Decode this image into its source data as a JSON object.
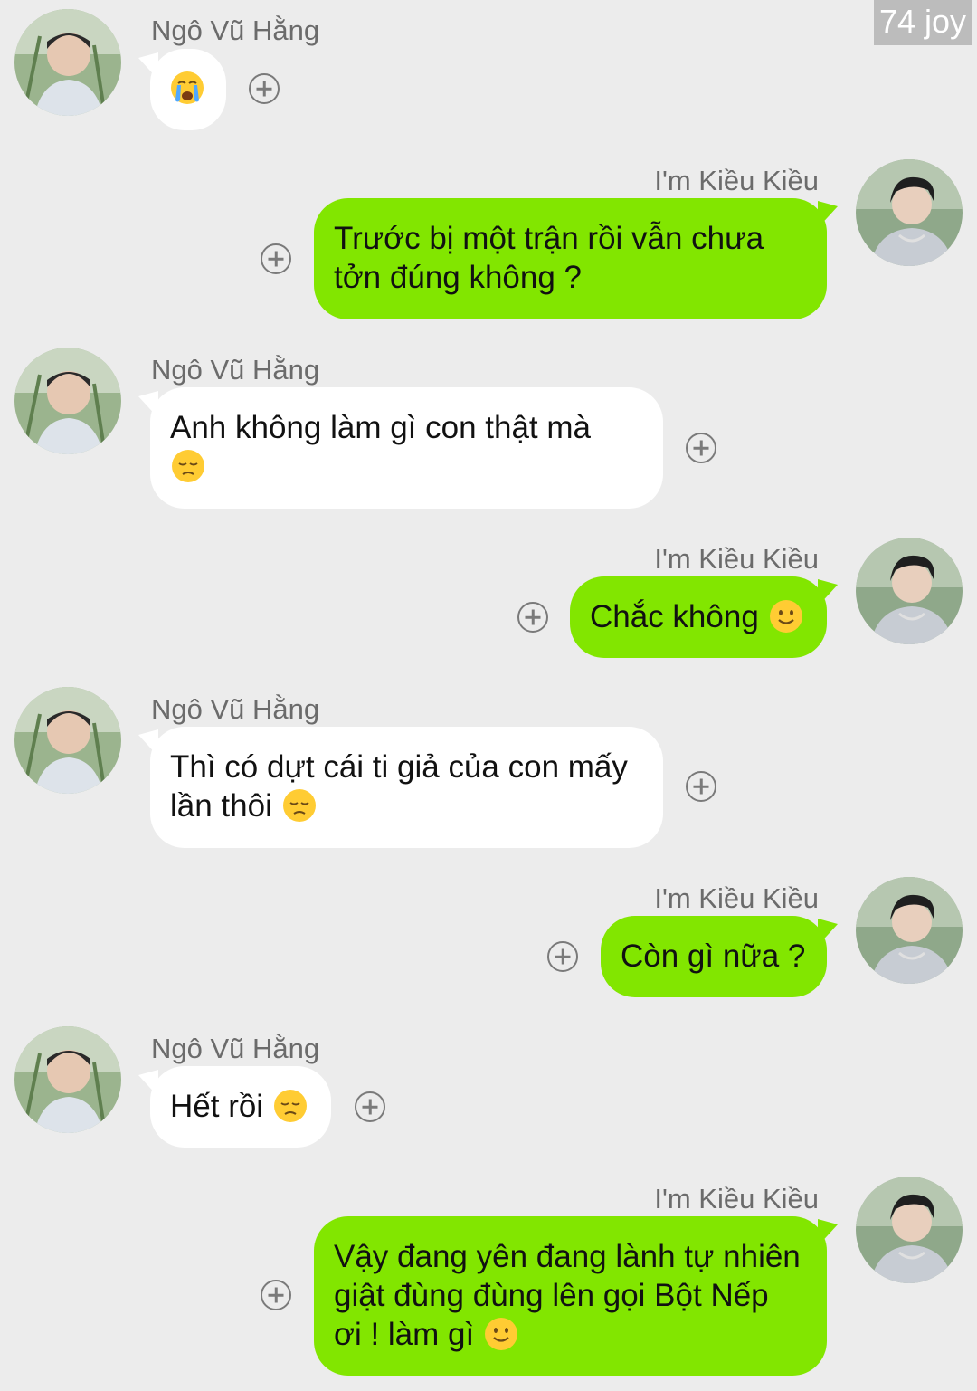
{
  "watermark": "74 joy",
  "contacts": {
    "other": "Ngô Vũ Hằng",
    "self": "I'm Kiều Kiều"
  },
  "messages": [
    {
      "from": "other",
      "text": "",
      "emoji": "crying-face"
    },
    {
      "from": "self",
      "text": "Trước bị một trận rồi vẫn chưa\ntởn đúng không ?",
      "emoji": ""
    },
    {
      "from": "other",
      "text": "Anh không làm gì con thật mà",
      "emoji": "pensive-face"
    },
    {
      "from": "self",
      "text": "Chắc không",
      "emoji": "slightly-smiling-face"
    },
    {
      "from": "other",
      "text": "Thì có dựt cái ti giả của con mấy\nlần thôi",
      "emoji": "pensive-face"
    },
    {
      "from": "self",
      "text": "Còn gì nữa ?",
      "emoji": ""
    },
    {
      "from": "other",
      "text": "Hết rồi",
      "emoji": "pensive-face"
    },
    {
      "from": "self",
      "text": "Vậy đang yên đang lành tự nhiên\ngiật đùng đùng lên gọi Bột Nếp\nơi ! làm gì",
      "emoji": "slightly-smiling-face"
    }
  ],
  "colors": {
    "background": "#ececec",
    "incoming_bubble": "#ffffff",
    "outgoing_bubble": "#82e600"
  }
}
